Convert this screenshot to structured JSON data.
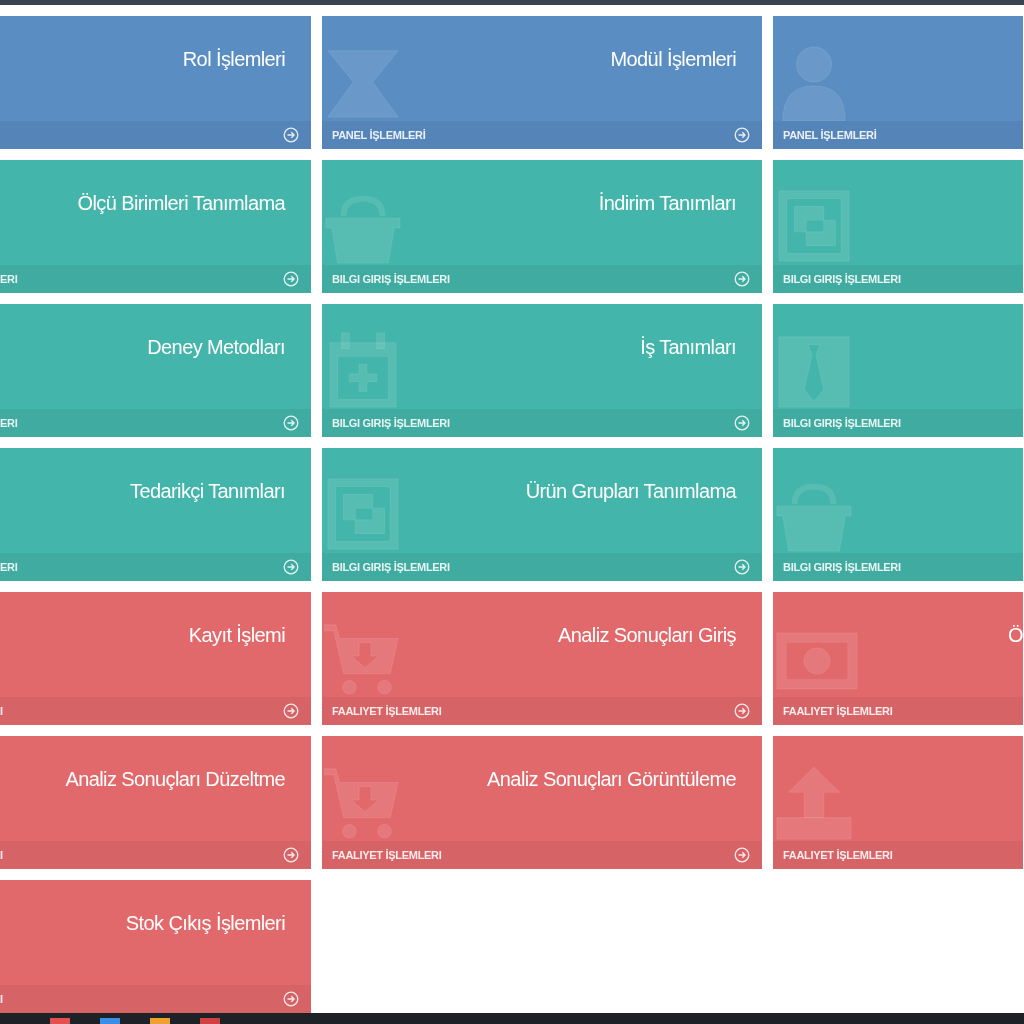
{
  "rows": [
    [
      {
        "title": "Rol İşlemleri",
        "color": "#5a8dc2"
      },
      {
        "title": "Modül İşlemleri",
        "category": "PANEL İŞLEMLERİ",
        "color": "#5a8dc2"
      },
      {
        "category": "PANEL İŞLEMLERİ",
        "color": "#5a8dc2"
      }
    ],
    [
      {
        "title": "Ölçü Birimleri Tanımlama",
        "category": "ERI",
        "color": "#44b5aa"
      },
      {
        "title": "İndirim Tanımları",
        "category": "BILGI GIRIŞ İŞLEMLERI",
        "color": "#44b5aa"
      },
      {
        "category": "BILGI GIRIŞ İŞLEMLERI",
        "color": "#44b5aa"
      }
    ],
    [
      {
        "title": "Deney Metodları",
        "category": "ERI",
        "color": "#44b5aa"
      },
      {
        "title": "İş Tanımları",
        "category": "BILGI GIRIŞ İŞLEMLERI",
        "color": "#44b5aa"
      },
      {
        "category": "BILGI GIRIŞ İŞLEMLERI",
        "color": "#44b5aa"
      }
    ],
    [
      {
        "title": "Tedarikçi Tanımları",
        "category": "ERI",
        "color": "#44b5aa"
      },
      {
        "title": "Ürün Grupları Tanımlama",
        "category": "BILGI GIRIŞ İŞLEMLERI",
        "color": "#44b5aa"
      },
      {
        "category": "BILGI GIRIŞ İŞLEMLERI",
        "color": "#44b5aa"
      }
    ],
    [
      {
        "title": "Kayıt İşlemi",
        "category": "I",
        "color": "#e2696b"
      },
      {
        "title": "Analiz Sonuçları Giriş",
        "category": "FAALIYET İŞLEMLERI",
        "color": "#e2696b"
      },
      {
        "title": "Ö",
        "category": "FAALIYET İŞLEMLERI",
        "color": "#e2696b"
      }
    ],
    [
      {
        "title": "Analiz Sonuçları Düzeltme",
        "category": "I",
        "color": "#e2696b"
      },
      {
        "title": "Analiz Sonuçları Görüntüleme",
        "category": "FAALIYET İŞLEMLERI",
        "color": "#e2696b"
      },
      {
        "category": "FAALIYET İŞLEMLERI",
        "color": "#e2696b"
      }
    ],
    [
      {
        "title": "Stok Çıkış İşlemleri",
        "category": "I",
        "color": "#e2696b"
      }
    ]
  ]
}
